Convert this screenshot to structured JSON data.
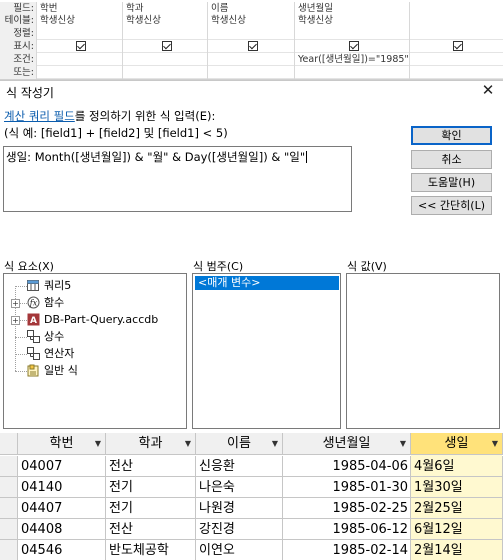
{
  "design_grid": {
    "row_labels": [
      "필드:",
      "테이블:",
      "정렬:",
      "표시:",
      "조건:",
      "또는:"
    ],
    "columns": [
      {
        "field": "학번",
        "table": "학생신상",
        "sort": "",
        "show": true,
        "criteria": ""
      },
      {
        "field": "학과",
        "table": "학생신상",
        "sort": "",
        "show": true,
        "criteria": ""
      },
      {
        "field": "이름",
        "table": "학생신상",
        "sort": "",
        "show": true,
        "criteria": ""
      },
      {
        "field": "생년월일",
        "table": "학생신상",
        "sort": "",
        "show": true,
        "criteria": "Year([생년월일])=\"1985\""
      },
      {
        "field": "",
        "table": "",
        "sort": "",
        "show": true,
        "criteria": ""
      }
    ]
  },
  "dialog": {
    "title": "식 작성기",
    "close_glyph": "✕",
    "instruction_link": "계산 쿼리 필드",
    "instruction_rest": "를 정의하기 위한 식 입력(E):",
    "example": "(식 예: [field1] + [field2] 및 [field1] < 5)",
    "expression": "생일: Month([생년월일]) & \"월\" & Day([생년월일]) & \"일\"",
    "buttons": {
      "ok": "확인",
      "cancel": "취소",
      "help": "도움말(H)",
      "less": "<< 간단히(L)"
    },
    "elements_label": "식 요소(X)",
    "categories_label": "식 범주(C)",
    "values_label": "식 값(V)",
    "elements": [
      {
        "label": "쿼리5",
        "icon": "query-icon",
        "expandable": false
      },
      {
        "label": "함수",
        "icon": "function-icon",
        "expandable": true
      },
      {
        "label": "DB-Part-Query.accdb",
        "icon": "database-icon",
        "expandable": true
      },
      {
        "label": "상수",
        "icon": "constants-icon",
        "expandable": false
      },
      {
        "label": "연산자",
        "icon": "operators-icon",
        "expandable": false
      },
      {
        "label": "일반 식",
        "icon": "common-expressions-icon",
        "expandable": false
      }
    ],
    "categories": [
      "<매개 변수>"
    ]
  },
  "datasheet": {
    "headers": [
      "학번",
      "학과",
      "이름",
      "생년월일",
      "생일"
    ],
    "rows": [
      [
        "04007",
        "전산",
        "신응환",
        "1985-04-06",
        "4월6일"
      ],
      [
        "04140",
        "전기",
        "나은숙",
        "1985-01-30",
        "1월30일"
      ],
      [
        "04407",
        "전기",
        "나원경",
        "1985-02-25",
        "2월25일"
      ],
      [
        "04408",
        "전산",
        "강진경",
        "1985-06-12",
        "6월12일"
      ],
      [
        "04546",
        "반도체공학",
        "이연오",
        "1985-02-14",
        "2월14일"
      ]
    ]
  }
}
